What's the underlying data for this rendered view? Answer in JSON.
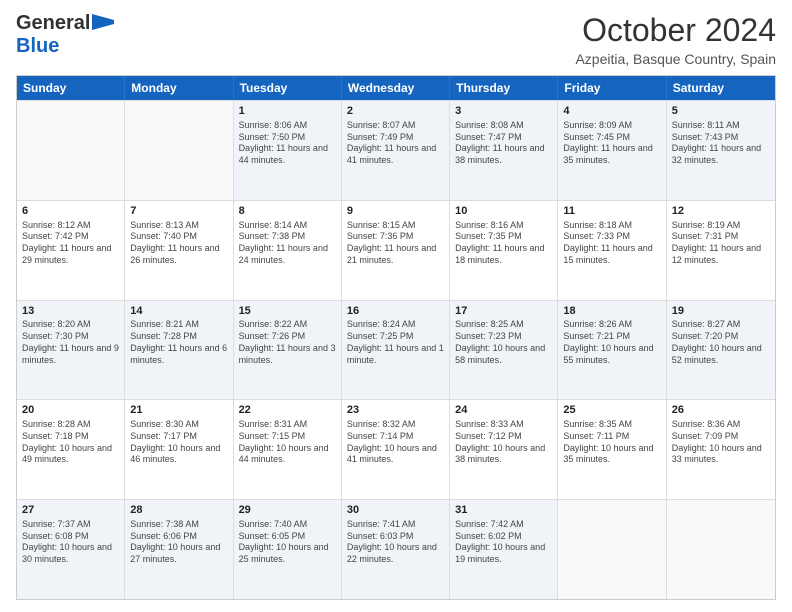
{
  "header": {
    "logo_general": "General",
    "logo_blue": "Blue",
    "month_title": "October 2024",
    "location": "Azpeitia, Basque Country, Spain"
  },
  "days_of_week": [
    "Sunday",
    "Monday",
    "Tuesday",
    "Wednesday",
    "Thursday",
    "Friday",
    "Saturday"
  ],
  "weeks": [
    [
      {
        "day": "",
        "info": ""
      },
      {
        "day": "",
        "info": ""
      },
      {
        "day": "1",
        "info": "Sunrise: 8:06 AM\nSunset: 7:50 PM\nDaylight: 11 hours and 44 minutes."
      },
      {
        "day": "2",
        "info": "Sunrise: 8:07 AM\nSunset: 7:49 PM\nDaylight: 11 hours and 41 minutes."
      },
      {
        "day": "3",
        "info": "Sunrise: 8:08 AM\nSunset: 7:47 PM\nDaylight: 11 hours and 38 minutes."
      },
      {
        "day": "4",
        "info": "Sunrise: 8:09 AM\nSunset: 7:45 PM\nDaylight: 11 hours and 35 minutes."
      },
      {
        "day": "5",
        "info": "Sunrise: 8:11 AM\nSunset: 7:43 PM\nDaylight: 11 hours and 32 minutes."
      }
    ],
    [
      {
        "day": "6",
        "info": "Sunrise: 8:12 AM\nSunset: 7:42 PM\nDaylight: 11 hours and 29 minutes."
      },
      {
        "day": "7",
        "info": "Sunrise: 8:13 AM\nSunset: 7:40 PM\nDaylight: 11 hours and 26 minutes."
      },
      {
        "day": "8",
        "info": "Sunrise: 8:14 AM\nSunset: 7:38 PM\nDaylight: 11 hours and 24 minutes."
      },
      {
        "day": "9",
        "info": "Sunrise: 8:15 AM\nSunset: 7:36 PM\nDaylight: 11 hours and 21 minutes."
      },
      {
        "day": "10",
        "info": "Sunrise: 8:16 AM\nSunset: 7:35 PM\nDaylight: 11 hours and 18 minutes."
      },
      {
        "day": "11",
        "info": "Sunrise: 8:18 AM\nSunset: 7:33 PM\nDaylight: 11 hours and 15 minutes."
      },
      {
        "day": "12",
        "info": "Sunrise: 8:19 AM\nSunset: 7:31 PM\nDaylight: 11 hours and 12 minutes."
      }
    ],
    [
      {
        "day": "13",
        "info": "Sunrise: 8:20 AM\nSunset: 7:30 PM\nDaylight: 11 hours and 9 minutes."
      },
      {
        "day": "14",
        "info": "Sunrise: 8:21 AM\nSunset: 7:28 PM\nDaylight: 11 hours and 6 minutes."
      },
      {
        "day": "15",
        "info": "Sunrise: 8:22 AM\nSunset: 7:26 PM\nDaylight: 11 hours and 3 minutes."
      },
      {
        "day": "16",
        "info": "Sunrise: 8:24 AM\nSunset: 7:25 PM\nDaylight: 11 hours and 1 minute."
      },
      {
        "day": "17",
        "info": "Sunrise: 8:25 AM\nSunset: 7:23 PM\nDaylight: 10 hours and 58 minutes."
      },
      {
        "day": "18",
        "info": "Sunrise: 8:26 AM\nSunset: 7:21 PM\nDaylight: 10 hours and 55 minutes."
      },
      {
        "day": "19",
        "info": "Sunrise: 8:27 AM\nSunset: 7:20 PM\nDaylight: 10 hours and 52 minutes."
      }
    ],
    [
      {
        "day": "20",
        "info": "Sunrise: 8:28 AM\nSunset: 7:18 PM\nDaylight: 10 hours and 49 minutes."
      },
      {
        "day": "21",
        "info": "Sunrise: 8:30 AM\nSunset: 7:17 PM\nDaylight: 10 hours and 46 minutes."
      },
      {
        "day": "22",
        "info": "Sunrise: 8:31 AM\nSunset: 7:15 PM\nDaylight: 10 hours and 44 minutes."
      },
      {
        "day": "23",
        "info": "Sunrise: 8:32 AM\nSunset: 7:14 PM\nDaylight: 10 hours and 41 minutes."
      },
      {
        "day": "24",
        "info": "Sunrise: 8:33 AM\nSunset: 7:12 PM\nDaylight: 10 hours and 38 minutes."
      },
      {
        "day": "25",
        "info": "Sunrise: 8:35 AM\nSunset: 7:11 PM\nDaylight: 10 hours and 35 minutes."
      },
      {
        "day": "26",
        "info": "Sunrise: 8:36 AM\nSunset: 7:09 PM\nDaylight: 10 hours and 33 minutes."
      }
    ],
    [
      {
        "day": "27",
        "info": "Sunrise: 7:37 AM\nSunset: 6:08 PM\nDaylight: 10 hours and 30 minutes."
      },
      {
        "day": "28",
        "info": "Sunrise: 7:38 AM\nSunset: 6:06 PM\nDaylight: 10 hours and 27 minutes."
      },
      {
        "day": "29",
        "info": "Sunrise: 7:40 AM\nSunset: 6:05 PM\nDaylight: 10 hours and 25 minutes."
      },
      {
        "day": "30",
        "info": "Sunrise: 7:41 AM\nSunset: 6:03 PM\nDaylight: 10 hours and 22 minutes."
      },
      {
        "day": "31",
        "info": "Sunrise: 7:42 AM\nSunset: 6:02 PM\nDaylight: 10 hours and 19 minutes."
      },
      {
        "day": "",
        "info": ""
      },
      {
        "day": "",
        "info": ""
      }
    ]
  ],
  "alt_rows": [
    0,
    2,
    4
  ]
}
